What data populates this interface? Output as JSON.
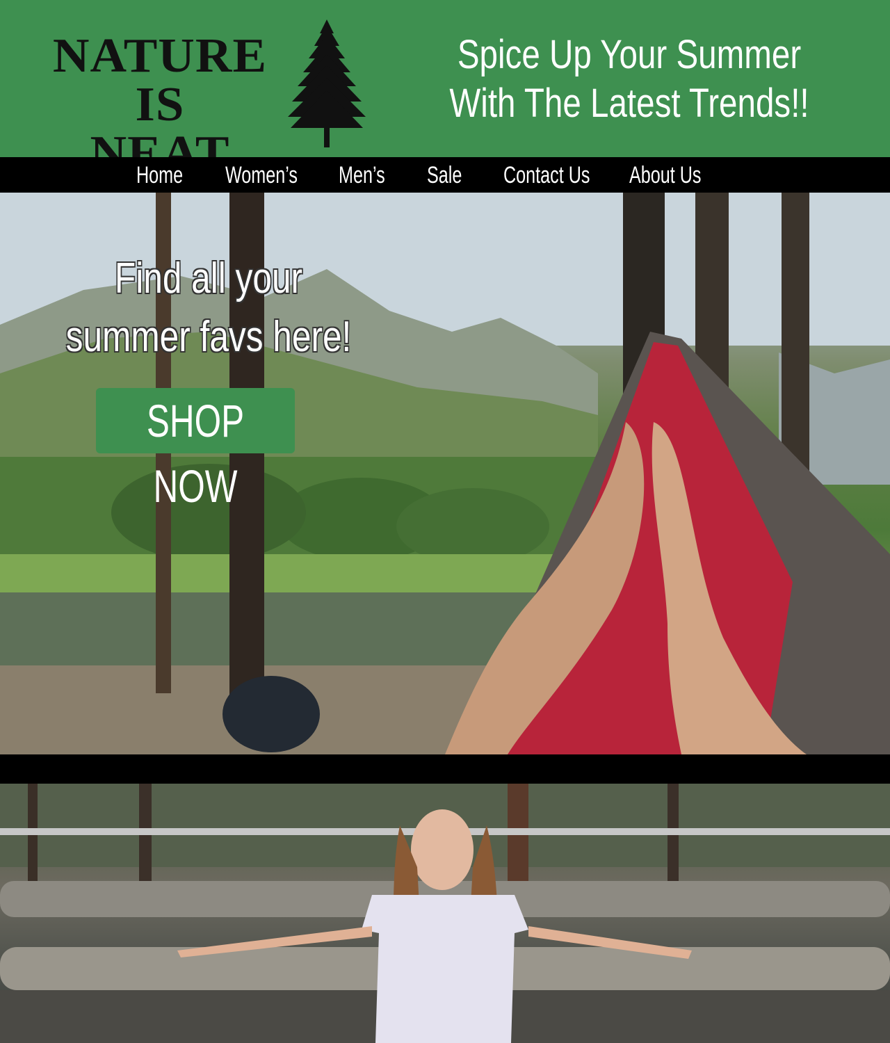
{
  "brand": {
    "logo_line1": "NATURE IS",
    "logo_line2": "NEAT",
    "tagline": "Spice Up Your Summer With The Latest Trends!!",
    "header_color": "#3e9050"
  },
  "nav": {
    "items": [
      {
        "label": "Home"
      },
      {
        "label": "Women’s"
      },
      {
        "label": "Men’s"
      },
      {
        "label": "Sale"
      },
      {
        "label": "Contact Us"
      },
      {
        "label": "About Us"
      }
    ]
  },
  "hero": {
    "caption": "Find all your summer favs here!",
    "cta_label": "SHOP NOW",
    "cta_color": "#3e9050",
    "photo": "hammock-by-mountain-lake-photo"
  },
  "feature": {
    "photo": "woman-on-wooden-bridge-photo"
  }
}
